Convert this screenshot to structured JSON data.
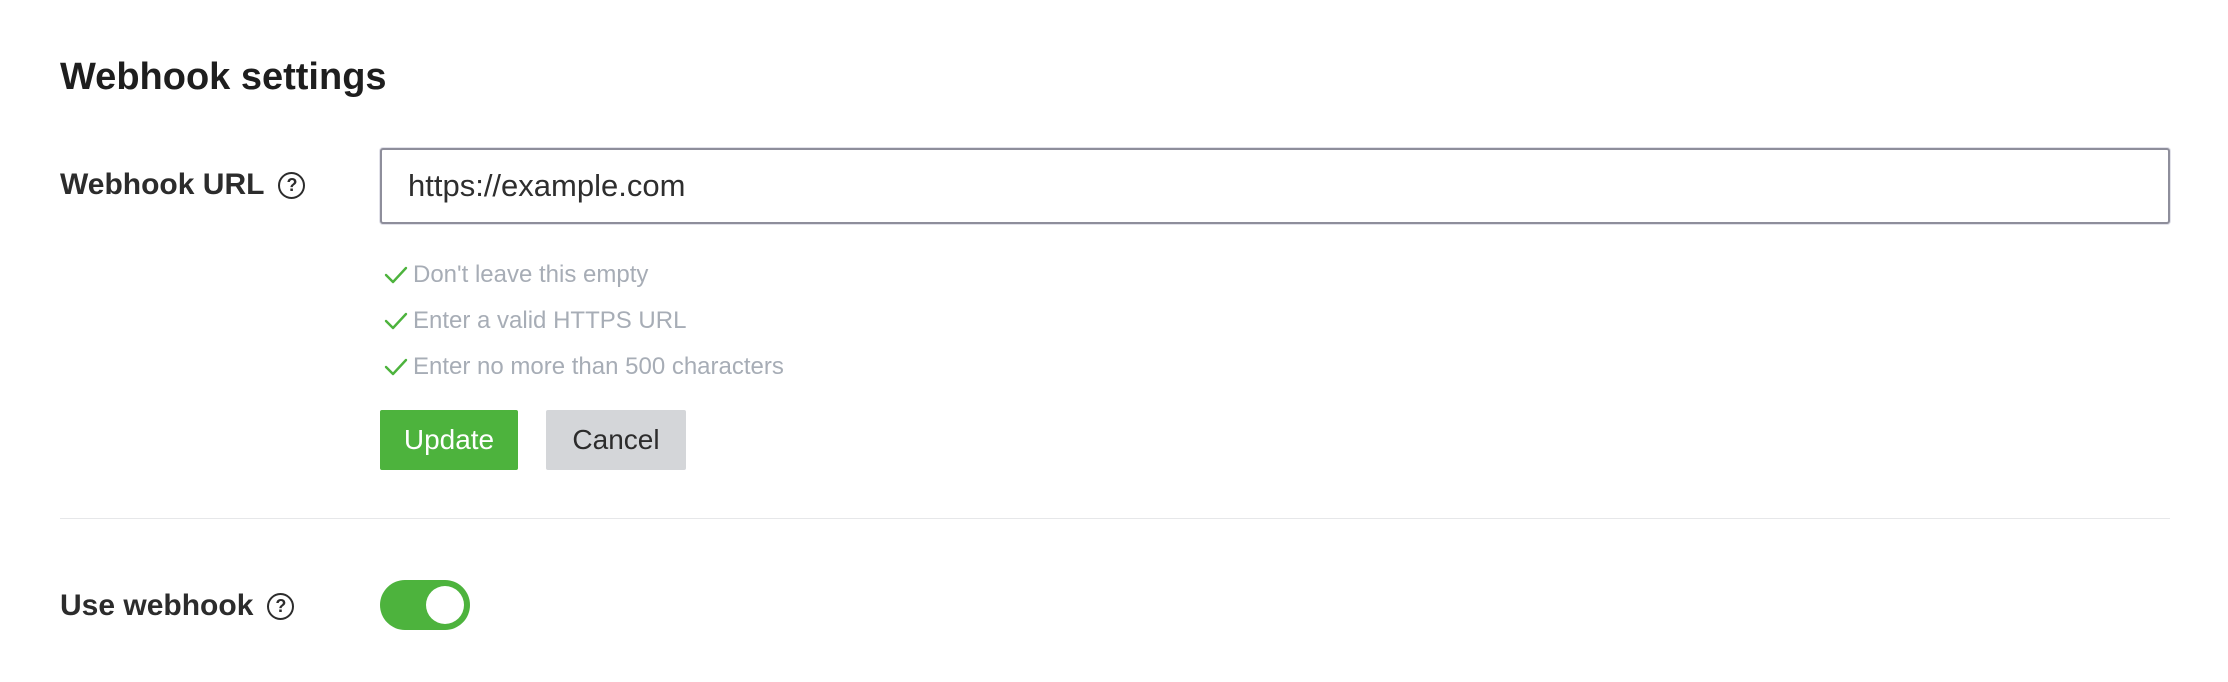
{
  "section": {
    "title": "Webhook settings"
  },
  "webhook_url": {
    "label": "Webhook URL",
    "help_icon": "question-circle-icon",
    "help_glyph": "?",
    "value": "https://example.com"
  },
  "validation": {
    "icon": "check-icon",
    "color": "#4db33d",
    "rules": [
      "Don't leave this empty",
      "Enter a valid HTTPS URL",
      "Enter no more than 500 characters"
    ]
  },
  "buttons": {
    "update_label": "Update",
    "cancel_label": "Cancel",
    "update_color": "#4db33d"
  },
  "use_webhook": {
    "label": "Use webhook",
    "help_icon": "question-circle-icon",
    "help_glyph": "?",
    "enabled": true,
    "toggle_color": "#4db33d"
  }
}
